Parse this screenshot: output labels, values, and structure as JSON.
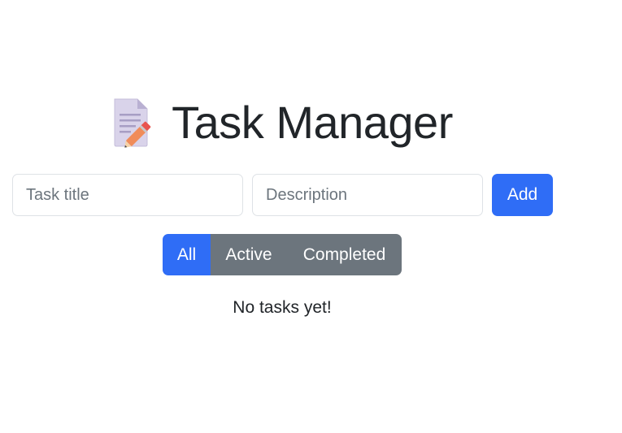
{
  "header": {
    "icon": "memo-pencil-icon",
    "title": "Task Manager"
  },
  "form": {
    "title_placeholder": "Task title",
    "title_value": "",
    "description_placeholder": "Description",
    "description_value": "",
    "add_label": "Add"
  },
  "filters": {
    "items": [
      {
        "label": "All",
        "active": true
      },
      {
        "label": "Active",
        "active": false
      },
      {
        "label": "Completed",
        "active": false
      }
    ]
  },
  "tasks": {
    "empty_message": "No tasks yet!"
  },
  "colors": {
    "primary": "#2f6df6",
    "secondary": "#6c757d",
    "text": "#212529"
  }
}
